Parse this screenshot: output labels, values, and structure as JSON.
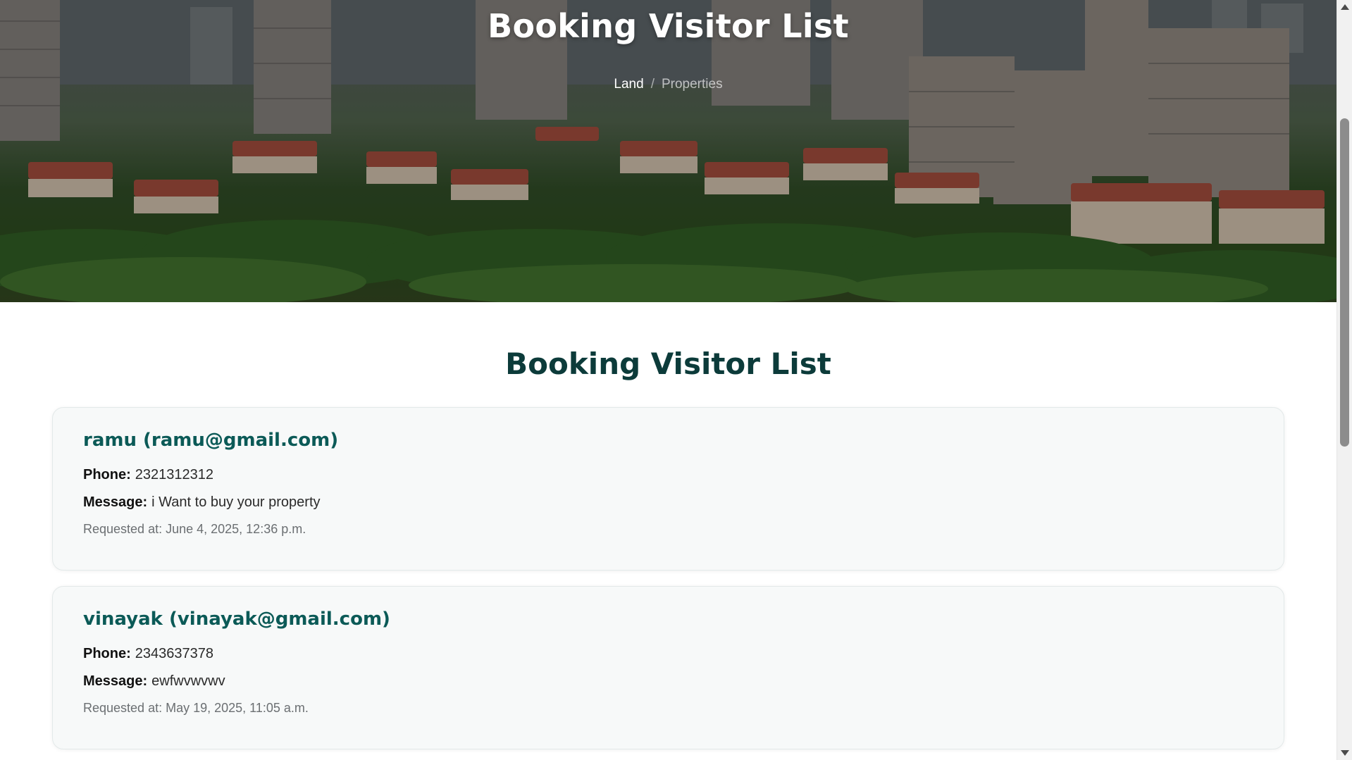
{
  "hero": {
    "title": "Booking Visitor List",
    "breadcrumb": {
      "active": "Land",
      "separator": "/",
      "current": "Properties"
    }
  },
  "main": {
    "title": "Booking Visitor List",
    "bookings": [
      {
        "heading": "ramu (ramu@gmail.com)",
        "phone_label": "Phone:",
        "phone": "2321312312",
        "message_label": "Message:",
        "message": "i Want to buy your property",
        "requested": "Requested at: June 4, 2025, 12:36 p.m."
      },
      {
        "heading": "vinayak (vinayak@gmail.com)",
        "phone_label": "Phone:",
        "phone": "2343637378",
        "message_label": "Message:",
        "message": "ewfwvwvwv",
        "requested": "Requested at: May 19, 2025, 11:05 a.m."
      }
    ]
  },
  "colors": {
    "title_dark": "#0c3b3a",
    "card_heading": "#0b5a57",
    "card_bg": "#f7f9f9"
  }
}
